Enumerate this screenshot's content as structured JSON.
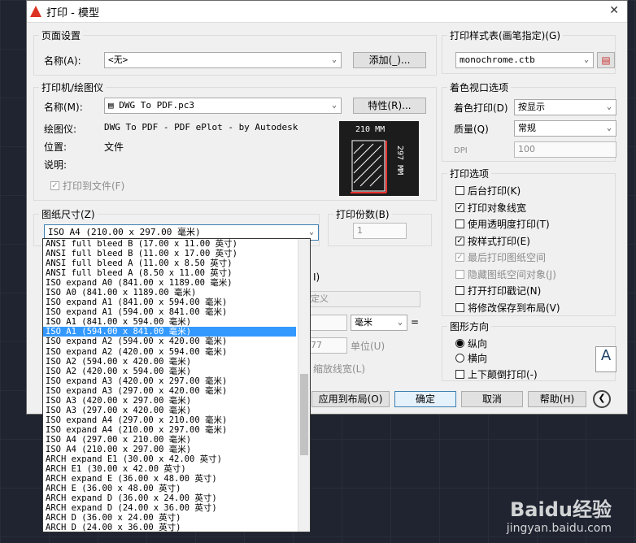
{
  "window": {
    "title": "打印 - 模型"
  },
  "page_setup": {
    "title": "页面设置",
    "name_label": "名称(A):",
    "name_value": "<无>",
    "add_btn": "添加(_)..."
  },
  "printer": {
    "title": "打印机/绘图仪",
    "name_label": "名称(M):",
    "name_value": "DWG To PDF.pc3",
    "props_btn": "特性(R)...",
    "plotter_label": "绘图仪:",
    "plotter_value": "DWG To PDF - PDF ePlot - by Autodesk",
    "location_label": "位置:",
    "location_value": "文件",
    "desc_label": "说明:",
    "print_to_file": "打印到文件(F)",
    "paper_w": "210 MM",
    "paper_h": "297 MM"
  },
  "paper_size": {
    "title": "图纸尺寸(Z)",
    "value": "ISO A4 (210.00 x 297.00 毫米)"
  },
  "copies": {
    "title": "打印份数(B)",
    "value": "1"
  },
  "plot_style": {
    "title": "打印样式表(画笔指定)(G)",
    "value": "monochrome.ctb"
  },
  "shaded": {
    "title": "着色视口选项",
    "shade_label": "着色打印(D)",
    "shade_value": "按显示",
    "quality_label": "质量(Q)",
    "quality_value": "常规",
    "dpi_label": "DPI",
    "dpi_value": "100"
  },
  "options": {
    "title": "打印选项",
    "items": [
      {
        "label": "后台打印(K)",
        "checked": ""
      },
      {
        "label": "打印对象线宽",
        "checked": "✓"
      },
      {
        "label": "使用透明度打印(T)",
        "checked": ""
      },
      {
        "label": "按样式打印(E)",
        "checked": "✓"
      },
      {
        "label": "最后打印图纸空间",
        "checked": "✓"
      },
      {
        "label": "隐藏图纸空间对象(J)",
        "checked": ""
      },
      {
        "label": "打开打印戳记(N)",
        "checked": ""
      },
      {
        "label": "将修改保存到布局(V)",
        "checked": ""
      }
    ]
  },
  "orientation": {
    "title": "图形方向",
    "portrait": "纵向",
    "landscape": "横向",
    "upside": "上下颠倒打印(-)",
    "icon": "A"
  },
  "mid": {
    "i_label": "I)",
    "def_value": "定义",
    "unit_value": "毫米",
    "unit2": "单位(U)",
    "num_value": "77",
    "scale_lw": "缩放线宽(L)"
  },
  "footer": {
    "apply": "应用到布局(O)",
    "ok": "确定",
    "cancel": "取消",
    "help": "帮助(H)"
  },
  "dropdown": {
    "items": [
      "ANSI full bleed B (17.00 x 11.00 英寸)",
      "ANSI full bleed B (11.00 x 17.00 英寸)",
      "ANSI full bleed A (11.00 x 8.50 英寸)",
      "ANSI full bleed A (8.50 x 11.00 英寸)",
      "ISO expand A0 (841.00 x 1189.00 毫米)",
      "ISO A0 (841.00 x 1189.00 毫米)",
      "ISO expand A1 (841.00 x 594.00 毫米)",
      "ISO expand A1 (594.00 x 841.00 毫米)",
      "ISO A1 (841.00 x 594.00 毫米)",
      "ISO A1 (594.00 x 841.00 毫米)",
      "ISO expand A2 (594.00 x 420.00 毫米)",
      "ISO expand A2 (420.00 x 594.00 毫米)",
      "ISO A2 (594.00 x 420.00 毫米)",
      "ISO A2 (420.00 x 594.00 毫米)",
      "ISO expand A3 (420.00 x 297.00 毫米)",
      "ISO expand A3 (297.00 x 420.00 毫米)",
      "ISO A3 (420.00 x 297.00 毫米)",
      "ISO A3 (297.00 x 420.00 毫米)",
      "ISO expand A4 (297.00 x 210.00 毫米)",
      "ISO expand A4 (210.00 x 297.00 毫米)",
      "ISO A4 (297.00 x 210.00 毫米)",
      "ISO A4 (210.00 x 297.00 毫米)",
      "ARCH expand E1 (30.00 x 42.00 英寸)",
      "ARCH E1 (30.00 x 42.00 英寸)",
      "ARCH expand E (36.00 x 48.00 英寸)",
      "ARCH E (36.00 x 48.00 英寸)",
      "ARCH expand D (36.00 x 24.00 英寸)",
      "ARCH expand D (24.00 x 36.00 英寸)",
      "ARCH D (36.00 x 24.00 英寸)",
      "ARCH D (24.00 x 36.00 英寸)"
    ],
    "selected_index": 9
  },
  "watermark": {
    "brand": "Baidu经验",
    "url": "jingyan.baidu.com"
  }
}
